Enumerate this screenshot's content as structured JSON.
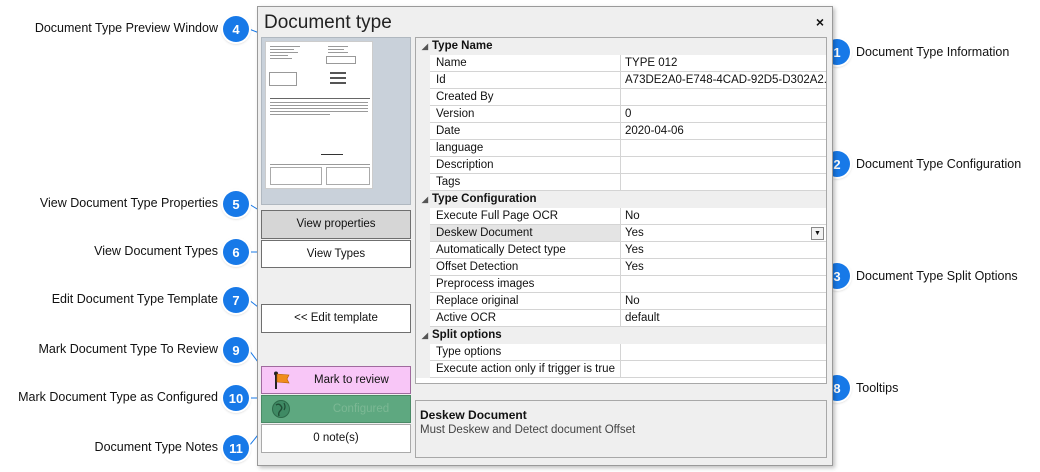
{
  "dialog": {
    "title": "Document type",
    "close_glyph": "×"
  },
  "buttons": {
    "view_properties": "View properties",
    "view_types": "View Types",
    "edit_template": "<< Edit template",
    "mark_to_review": "Mark to review",
    "mark_configured": "Configured",
    "notes": "0 note(s)"
  },
  "grid": {
    "categories": {
      "type_name": "Type Name",
      "type_configuration": "Type Configuration",
      "split_options": "Split options"
    },
    "type_name_rows": [
      {
        "name": "Name",
        "value": "TYPE 012"
      },
      {
        "name": "Id",
        "value": "A73DE2A0-E748-4CAD-92D5-D302A2..."
      },
      {
        "name": "Created By",
        "value": ""
      },
      {
        "name": "Version",
        "value": "0"
      },
      {
        "name": "Date",
        "value": "2020-04-06"
      },
      {
        "name": "language",
        "value": ""
      },
      {
        "name": "Description",
        "value": ""
      },
      {
        "name": "Tags",
        "value": ""
      }
    ],
    "type_configuration_rows": [
      {
        "name": "Execute Full Page OCR",
        "value": "No"
      },
      {
        "name": "Deskew Document",
        "value": "Yes"
      },
      {
        "name": "Automatically Detect type",
        "value": "Yes"
      },
      {
        "name": "Offset Detection",
        "value": "Yes"
      },
      {
        "name": "Preprocess images",
        "value": ""
      },
      {
        "name": "Replace original",
        "value": "No"
      },
      {
        "name": "Active OCR",
        "value": "default"
      }
    ],
    "split_options_rows": [
      {
        "name": "Type options",
        "value": ""
      },
      {
        "name": "Execute action only if trigger is true",
        "value": ""
      }
    ]
  },
  "description_pane": {
    "title": "Deskew Document",
    "text": "Must Deskew and Detect document Offset"
  },
  "callouts": [
    {
      "number": "1",
      "label": "Document Type Information"
    },
    {
      "number": "2",
      "label": "Document Type Configuration"
    },
    {
      "number": "3",
      "label": "Document Type Split Options"
    },
    {
      "number": "4",
      "label": "Document Type Preview Window"
    },
    {
      "number": "5",
      "label": "View Document Type Properties"
    },
    {
      "number": "6",
      "label": "View Document Types"
    },
    {
      "number": "7",
      "label": "Edit Document Type Template"
    },
    {
      "number": "8",
      "label": "Tooltips"
    },
    {
      "number": "9",
      "label": "Mark Document Type To Review"
    },
    {
      "number": "10",
      "label": "Mark Document Type as Configured"
    },
    {
      "number": "11",
      "label": "Document Type Notes"
    }
  ],
  "colors": {
    "badge": "#1779e8",
    "leader_line": "#1779e8",
    "mark_review_bg": "#f8c6f7",
    "configured_bg": "#5ea880",
    "view_properties_bg": "#d6d6d6"
  }
}
